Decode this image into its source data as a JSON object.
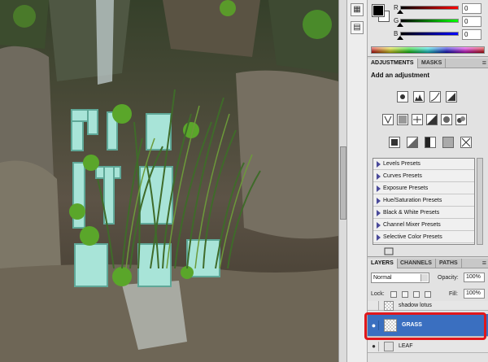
{
  "color_panel": {
    "channels": [
      {
        "label": "R",
        "value": "0",
        "color": "#e04040"
      },
      {
        "label": "G",
        "value": "0",
        "color": "#40c040"
      },
      {
        "label": "B",
        "value": "0",
        "color": "#4040e0"
      }
    ],
    "foreground": "#000000",
    "background": "#ffffff"
  },
  "adjustments_panel": {
    "tabs": [
      {
        "label": "ADJUSTMENTS",
        "active": true
      },
      {
        "label": "MASKS",
        "active": false
      }
    ],
    "title": "Add an adjustment",
    "presets": [
      "Levels Presets",
      "Curves Presets",
      "Exposure Presets",
      "Hue/Saturation Presets",
      "Black & White Presets",
      "Channel Mixer Presets",
      "Selective Color Presets"
    ]
  },
  "layers_panel": {
    "tabs": [
      {
        "label": "LAYERS",
        "active": true
      },
      {
        "label": "CHANNELS",
        "active": false
      },
      {
        "label": "PATHS",
        "active": false
      }
    ],
    "blend_mode": "Normal",
    "opacity_label": "Opacity:",
    "opacity_value": "100%",
    "lock_label": "Lock:",
    "fill_label": "Fill:",
    "fill_value": "100%",
    "layers": [
      {
        "name": "shadow lotus",
        "selected": false
      },
      {
        "name": "GRASS",
        "selected": true
      },
      {
        "name": "LEAF",
        "selected": false
      }
    ]
  },
  "accent": "#e0181c",
  "selection_color": "#3a6fc0"
}
